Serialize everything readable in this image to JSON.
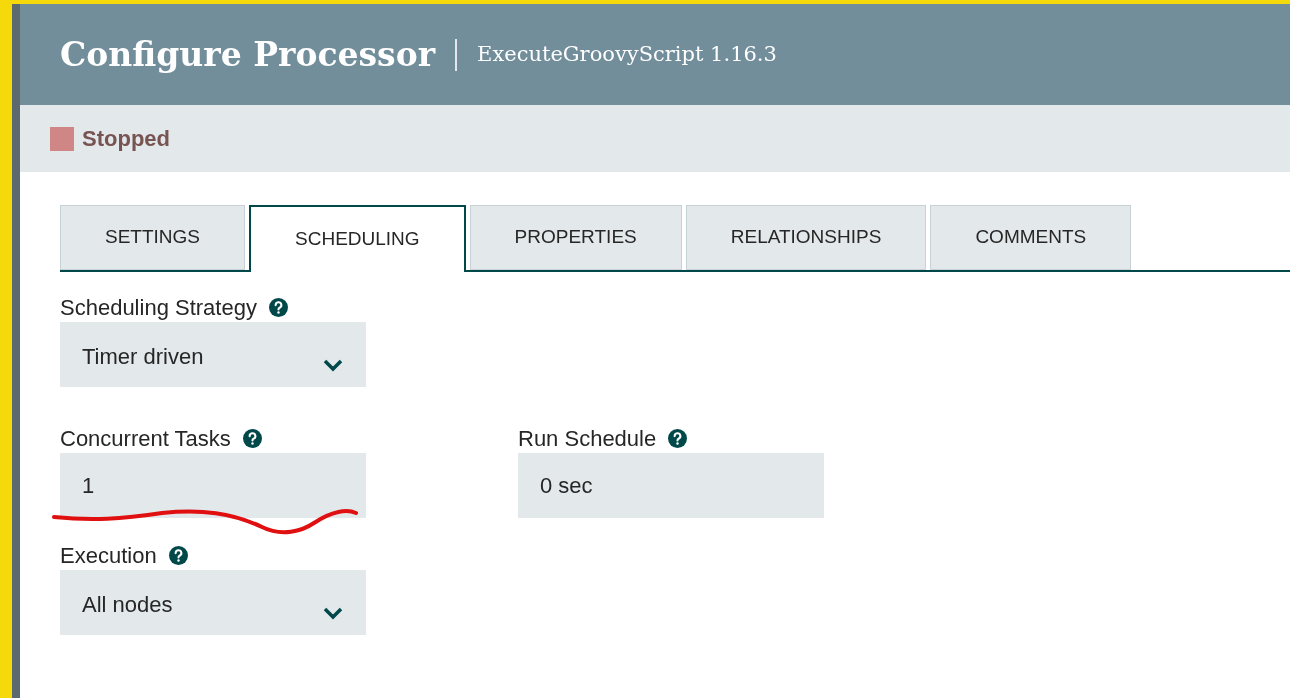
{
  "header": {
    "title": "Configure Processor",
    "subtitle": "ExecuteGroovyScript 1.16.3"
  },
  "status": {
    "color": "#d18686",
    "label": "Stopped"
  },
  "tabs": [
    {
      "label": "SETTINGS",
      "selected": false
    },
    {
      "label": "SCHEDULING",
      "selected": true
    },
    {
      "label": "PROPERTIES",
      "selected": false
    },
    {
      "label": "RELATIONSHIPS",
      "selected": false
    },
    {
      "label": "COMMENTS",
      "selected": false
    }
  ],
  "fields": [
    {
      "kind": "select",
      "label": "Scheduling Strategy",
      "value": "Timer driven"
    },
    {
      "kind": "pair",
      "items": [
        {
          "label": "Concurrent Tasks",
          "value": "1",
          "underlined": true
        },
        {
          "label": "Run Schedule",
          "value": "0 sec",
          "underlined": false
        }
      ]
    },
    {
      "kind": "select",
      "label": "Execution",
      "value": "All nodes"
    }
  ]
}
